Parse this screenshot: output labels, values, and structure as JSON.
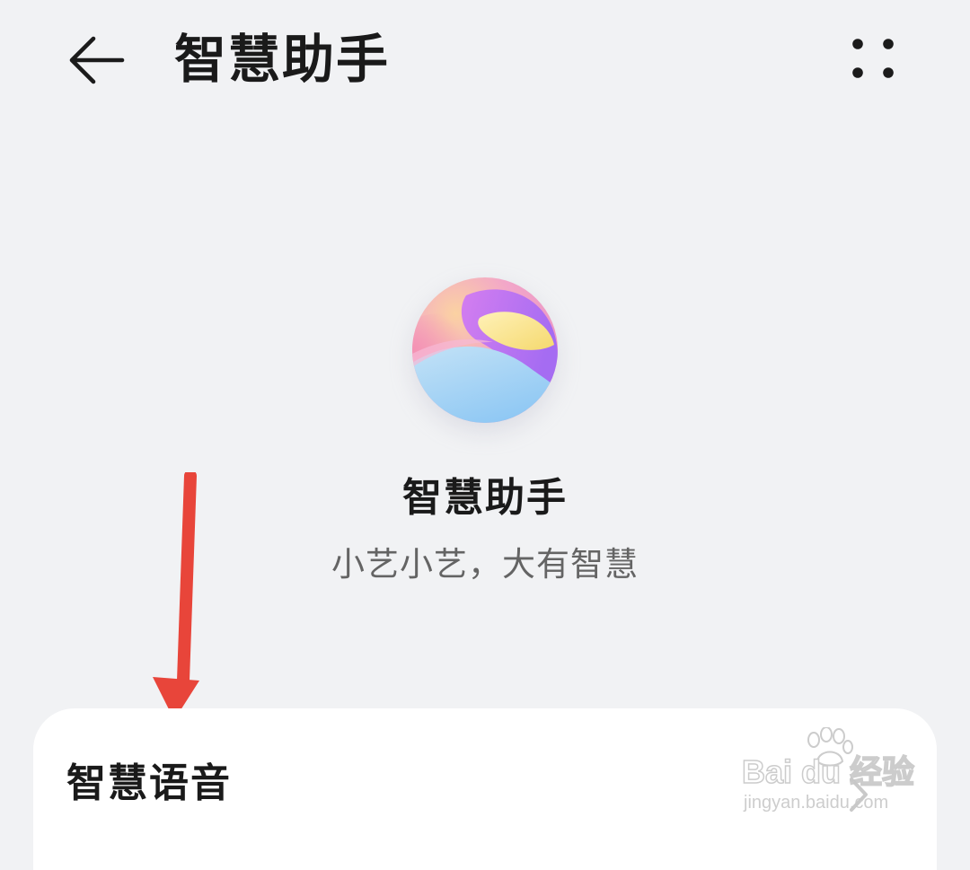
{
  "header": {
    "title": "智慧助手",
    "back_icon": "arrow-left-icon",
    "more_icon": "more-dots-icon"
  },
  "hero": {
    "logo_icon": "celia-assistant-logo",
    "name": "智慧助手",
    "slogan": "小艺小艺，大有智慧"
  },
  "settings": {
    "items": [
      {
        "label": "智慧语音",
        "icon": "chevron-right-icon"
      }
    ]
  },
  "annotation": {
    "arrow_color": "#e8453a"
  },
  "watermark": {
    "brand": "Bai du 经验",
    "url": "jingyan.baidu.com"
  },
  "colors": {
    "background": "#f1f2f4",
    "card": "#ffffff",
    "text_primary": "#1a1a1a",
    "text_secondary": "#646464"
  }
}
